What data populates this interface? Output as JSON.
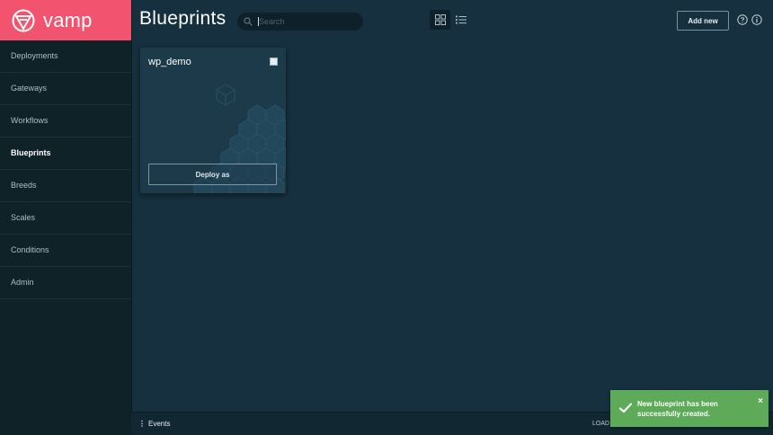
{
  "brand": {
    "name": "vamp",
    "color": "#f2546f"
  },
  "sidebar": {
    "items": [
      {
        "label": "Deployments"
      },
      {
        "label": "Gateways"
      },
      {
        "label": "Workflows"
      },
      {
        "label": "Blueprints",
        "active": true
      },
      {
        "label": "Breeds"
      },
      {
        "label": "Scales"
      },
      {
        "label": "Conditions"
      },
      {
        "label": "Admin"
      }
    ]
  },
  "header": {
    "title": "Blueprints",
    "search_placeholder": "Search",
    "add_new_label": "Add new",
    "view_mode": "grid"
  },
  "card": {
    "title": "wp_demo",
    "deploy_label": "Deploy as"
  },
  "footer": {
    "events_label": "Events",
    "load_label": "LOAD"
  },
  "toast": {
    "message": "New blueprint has been successfully created.",
    "close_label": "×",
    "color": "#5dab58"
  }
}
